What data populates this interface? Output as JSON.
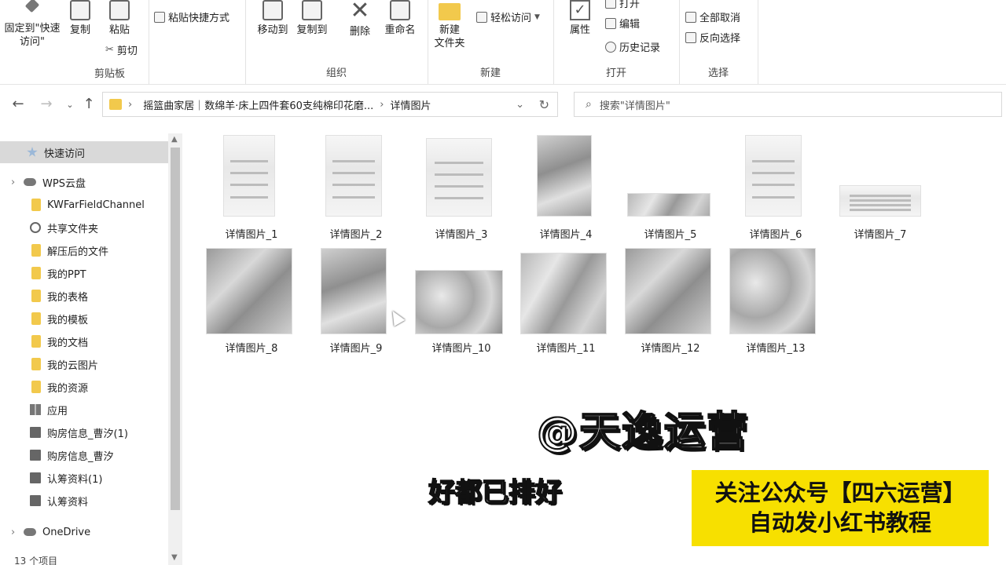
{
  "ribbon": {
    "clipboard": {
      "pin_label": "固定到\"快速访问\"",
      "copy_label": "复制",
      "paste_label": "粘贴",
      "cut_label": "剪切",
      "paste_shortcut_label": "粘贴快捷方式",
      "group_label": "剪贴板"
    },
    "organize": {
      "move_to_label": "移动到",
      "copy_to_label": "复制到",
      "delete_label": "删除",
      "rename_label": "重命名",
      "group_label": "组织"
    },
    "new": {
      "new_folder_label": "新建\n文件夹",
      "easy_access_label": "轻松访问",
      "group_label": "新建"
    },
    "open": {
      "properties_label": "属性",
      "open_label": "打开",
      "edit_label": "编辑",
      "history_label": "历史记录",
      "group_label": "打开"
    },
    "select": {
      "select_none_label": "全部取消",
      "invert_selection_label": "反向选择",
      "group_label": "选择"
    }
  },
  "address": {
    "path": [
      "摇篮曲家居｜数绵羊·床上四件套60支纯棉印花磨...",
      "详情图片"
    ],
    "search_placeholder": "搜索\"详情图片\""
  },
  "sidebar": {
    "items": [
      {
        "label": "快速访问",
        "icon": "star-icon",
        "selected": true
      },
      {
        "label": "WPS云盘",
        "icon": "cloud-icon"
      },
      {
        "label": "KWFarFieldChannel",
        "icon": "folder-icon"
      },
      {
        "label": "共享文件夹",
        "icon": "share-icon"
      },
      {
        "label": "解压后的文件",
        "icon": "folder-icon"
      },
      {
        "label": "我的PPT",
        "icon": "folder-icon"
      },
      {
        "label": "我的表格",
        "icon": "folder-icon"
      },
      {
        "label": "我的模板",
        "icon": "folder-icon"
      },
      {
        "label": "我的文档",
        "icon": "folder-icon"
      },
      {
        "label": "我的云图片",
        "icon": "folder-icon"
      },
      {
        "label": "我的资源",
        "icon": "folder-icon"
      },
      {
        "label": "应用",
        "icon": "grid-icon"
      },
      {
        "label": "购房信息_曹汐(1)",
        "icon": "document-icon"
      },
      {
        "label": "购房信息_曹汐",
        "icon": "document-icon"
      },
      {
        "label": "认筹资料(1)",
        "icon": "document-icon"
      },
      {
        "label": "认筹资料",
        "icon": "document-icon"
      },
      {
        "label": "OneDrive",
        "icon": "cloud-icon"
      }
    ],
    "status_text": "13 个项目"
  },
  "files": [
    {
      "name": "详情图片_1"
    },
    {
      "name": "详情图片_2"
    },
    {
      "name": "详情图片_3"
    },
    {
      "name": "详情图片_4"
    },
    {
      "name": "详情图片_5"
    },
    {
      "name": "详情图片_6"
    },
    {
      "name": "详情图片_7"
    },
    {
      "name": "详情图片_8"
    },
    {
      "name": "详情图片_9"
    },
    {
      "name": "详情图片_10"
    },
    {
      "name": "详情图片_11"
    },
    {
      "name": "详情图片_12"
    },
    {
      "name": "详情图片_13"
    }
  ],
  "overlay": {
    "watermark": "@天逸运营",
    "subtitle": "好都已排好",
    "promo_line1": "关注公众号【四六运营】",
    "promo_line2": "自动发小红书教程",
    "promo_color": "#f7e000"
  }
}
